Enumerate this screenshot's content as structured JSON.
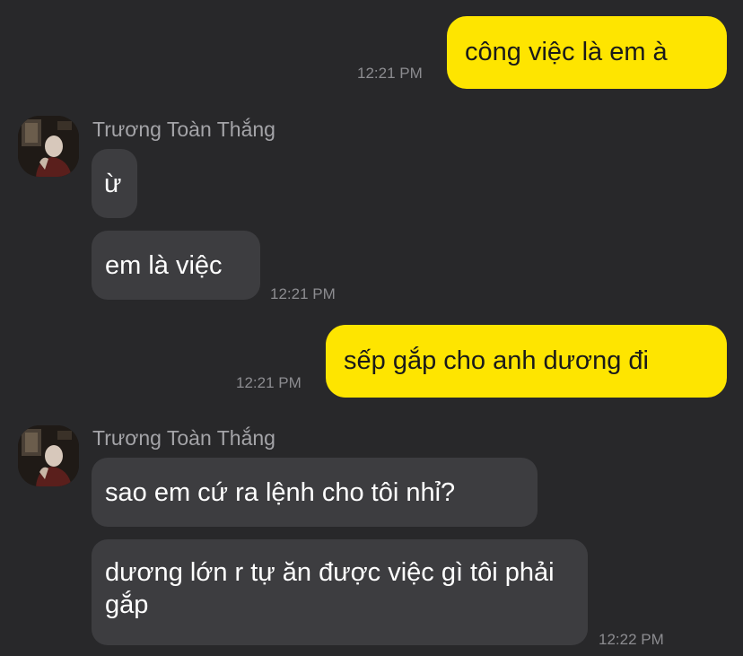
{
  "colors": {
    "background": "#28282a",
    "outgoing_bubble": "#fee500",
    "incoming_bubble": "#3d3d40",
    "timestamp": "#8c8c90",
    "sender_name": "#a4a4a8"
  },
  "messages": [
    {
      "direction": "outgoing",
      "text": "công việc là em à",
      "time": "12:21 PM"
    },
    {
      "direction": "incoming",
      "sender": "Trương Toàn Thắng",
      "avatar_icon": "contact-avatar-photo",
      "bubbles": [
        "ừ",
        "em là việc"
      ],
      "time": "12:21 PM"
    },
    {
      "direction": "outgoing",
      "text": "sếp gắp cho anh dương đi",
      "time": "12:21 PM"
    },
    {
      "direction": "incoming",
      "sender": "Trương Toàn Thắng",
      "avatar_icon": "contact-avatar-photo",
      "bubbles": [
        "sao em cứ ra lệnh cho tôi nhỉ?",
        "dương lớn r tự ăn được việc gì tôi phải gắp"
      ],
      "time": "12:22 PM"
    }
  ]
}
